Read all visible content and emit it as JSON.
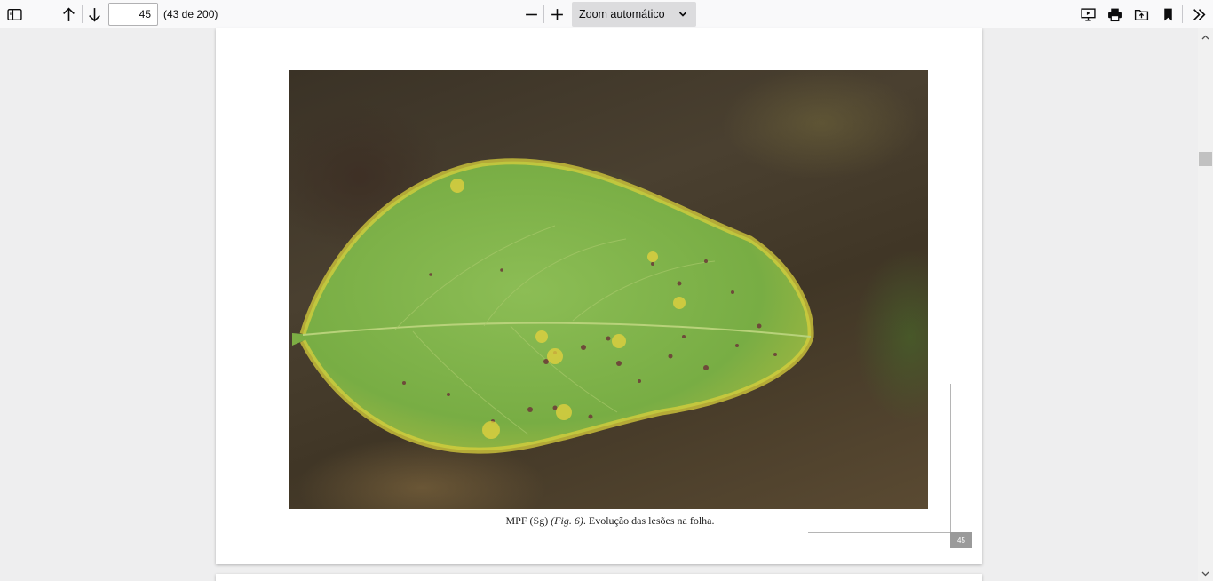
{
  "toolbar": {
    "page_number": "45",
    "page_count": "(43 de 200)",
    "zoom_label": "Zoom automático",
    "icons": {
      "sidebar": "sidebar-toggle-icon",
      "previous": "arrow-up-icon",
      "next": "arrow-down-icon",
      "zoom_out": "minus-icon",
      "zoom_in": "plus-icon",
      "presentation": "presentation-mode-icon",
      "print": "print-icon",
      "open": "open-file-icon",
      "bookmark": "bookmark-icon",
      "tools": "double-chevron-right-icon"
    }
  },
  "document": {
    "caption_prefix": "MPF (Sg) ",
    "caption_fig": "(Fig. 6)",
    "caption_suffix": ". Evolução das lesões na folha.",
    "page_label": "45"
  },
  "colors": {
    "toolbar_bg": "#f9f9fa",
    "viewer_bg": "#eeeeef",
    "leaf_green": "#7fb24a",
    "lesion_yellow": "#e2d13a"
  }
}
